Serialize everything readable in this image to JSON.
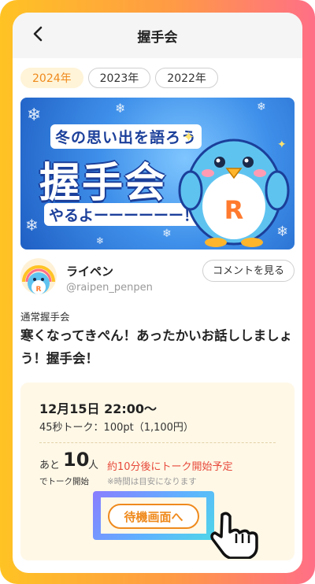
{
  "header": {
    "title": "握手会"
  },
  "tabs": [
    {
      "label": "2024年",
      "active": true
    },
    {
      "label": "2023年",
      "active": false
    },
    {
      "label": "2022年",
      "active": false
    }
  ],
  "banner": {
    "top_text": "冬の思い出を語ろう",
    "main_text": "握手会",
    "bottom_text": "やるよーーーーーー！"
  },
  "profile": {
    "name": "ライペン",
    "handle": "@raipen_penpen",
    "avatar_letter": "R",
    "comment_button": "コメントを見る"
  },
  "event": {
    "type": "通常握手会",
    "title": "寒くなってきぺん！あったかいお話ししましょう！握手会！"
  },
  "info": {
    "datetime": "12月15日 22:00〜",
    "price": "45秒トーク：100pt（1,100円）",
    "wait_prefix": "あと",
    "wait_count": "10",
    "wait_unit": "人",
    "wait_suffix": "でトーク開始",
    "estimate": "約10分後にトーク開始予定",
    "estimate_note": "※時間は目安になります",
    "button": "待機画面へ"
  },
  "colors": {
    "accent": "#ef8a1d",
    "alert": "#e74a3b",
    "frame_start": "#ffc324",
    "frame_end": "#ff6f86"
  }
}
